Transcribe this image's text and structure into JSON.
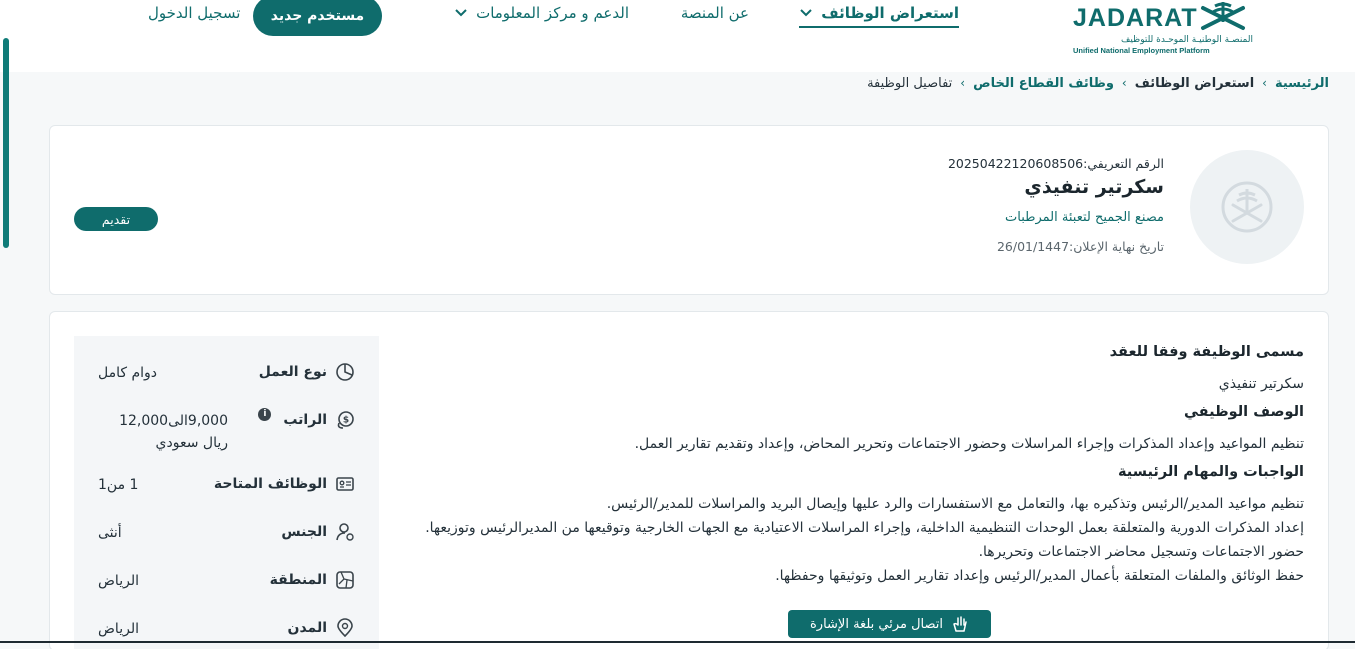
{
  "header": {
    "logo": {
      "word": "JADARAT",
      "arabic_name": "المنصـة الوطنيـة الموحـدة للتوظيف",
      "english_name": "Unified National Employment Platform"
    },
    "nav": {
      "browse_jobs": "استعراض الوظائف",
      "about": "عن المنصة",
      "support": "الدعم و مركز المعلومات"
    },
    "new_user_label": "مستخدم جديد",
    "login_label": "تسجيل الدخول"
  },
  "breadcrumb": {
    "home": "الرئيسية",
    "browse_jobs": "استعراض الوظائف",
    "private_sector": "وظائف القطاع الخاص",
    "current": "تفاصيل الوظيفة"
  },
  "job": {
    "id_text": "الرقم التعريفي:20250422120608506",
    "title": "سكرتير تنفيذي",
    "company": "مصنع الجميح لتعبئة المرطبات",
    "deadline_text": "تاريخ نهاية الإعلان:26/01/1447",
    "apply_label": "تقديم"
  },
  "details": {
    "contract_title_heading": "مسمى الوظيفة وفقا للعقد",
    "contract_title": "سكرتير تنفيذي",
    "description_heading": "الوصف الوظيفي",
    "description": "تنظيم المواعيد وإعداد المذكرات وإجراء المراسلات وحضور الاجتماعات وتحرير المحاض، وإعداد وتقديم تقارير العمل.",
    "duties_heading": "الواجبات والمهام الرئيسية",
    "duties": [
      "تنظيم مواعيد المدير/الرئيس وتذكيره بها، والتعامل مع الاستفسارات والرد عليها وإيصال البريد والمراسلات للمدير/الرئيس.",
      "إعداد المذكرات الدورية والمتعلقة بعمل الوحدات التنظيمية الداخلية، وإجراء المراسلات الاعتيادية مع الجهات الخارجية وتوقيعها من المديرالرئيس وتوزيعها.",
      "حضور الاجتماعات وتسجيل محاضر الاجتماعات وتحريرها.",
      "حفظ الوثائق والملفات المتعلقة بأعمال المدير/الرئيس وإعداد تقارير العمل وتوثيقها وحفظها."
    ]
  },
  "info": {
    "work_type_label": "نوع العمل",
    "work_type_value": "دوام كامل",
    "salary_label": "الراتب",
    "salary_value": "9,000الى12,000 ريال سعودي",
    "salary_info_badge": "i",
    "openings_label": "الوظائف المتاحة",
    "openings_value": "1 من1",
    "gender_label": "الجنس",
    "gender_value": "أنثى",
    "region_label": "المنطقة",
    "region_value": "الرياض",
    "city_label": "المدن",
    "city_value": "الرياض"
  },
  "sign_language_label": "اتصال مرئي بلغة الإشارة",
  "colors": {
    "brand": "#0f6c6c",
    "scroll_indicator": "#0f7b78"
  }
}
